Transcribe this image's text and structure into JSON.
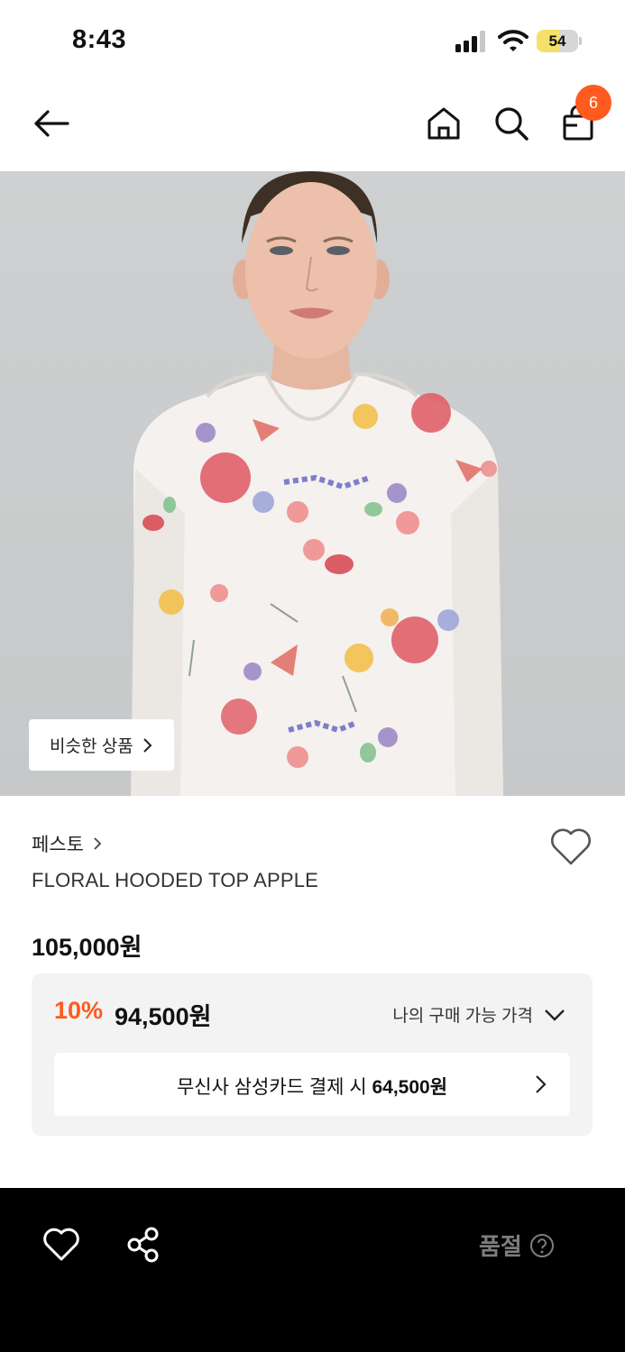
{
  "status_bar": {
    "time": "8:43",
    "battery_level": "54",
    "battery_percent": 54
  },
  "header": {
    "cart_count": "6"
  },
  "product_image": {
    "similar_label": "비슷한 상품"
  },
  "product": {
    "brand": "페스토",
    "name": "FLORAL HOODED TOP APPLE",
    "original_price": "105,000원",
    "discount_rate": "10%",
    "sale_price": "94,500원",
    "my_price_label": "나의 구매 가능 가격",
    "card_offer_prefix": "무신사 삼성카드 결제 시",
    "card_offer_price": "64,500원"
  },
  "bottom_bar": {
    "status_label": "품절"
  },
  "colors": {
    "accent": "#ff5a1f",
    "bottom_bar": "#000000",
    "price_box": "#f3f3f3"
  },
  "icons": [
    "back-arrow-icon",
    "home-icon",
    "search-icon",
    "shopping-bag-icon",
    "heart-icon",
    "share-icon",
    "question-circle-icon",
    "chevron-right-icon",
    "chevron-down-icon"
  ]
}
